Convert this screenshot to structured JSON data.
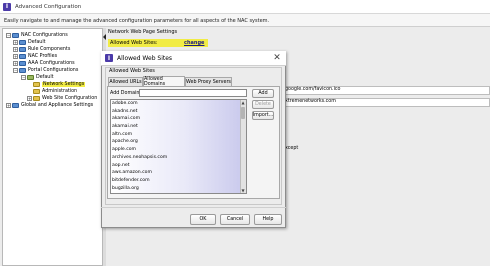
{
  "window": {
    "title": "Advanced Configuration"
  },
  "description": "Easily navigate to and manage the advanced configuration parameters for all aspects of the NAC system.",
  "tree": {
    "items": [
      {
        "label": "NAC Configurations",
        "toggle": "−"
      },
      {
        "label": "Default",
        "toggle": "+"
      },
      {
        "label": "Rule Components",
        "toggle": "+"
      },
      {
        "label": "NAC Profiles",
        "toggle": "+"
      },
      {
        "label": "AAA Configurations",
        "toggle": "+"
      },
      {
        "label": "Portal Configurations",
        "toggle": "−"
      },
      {
        "label": "Default",
        "toggle": "−"
      },
      {
        "label": "Network Settings",
        "toggle": ""
      },
      {
        "label": "Administration",
        "toggle": ""
      },
      {
        "label": "Web Site Configuration",
        "toggle": "+"
      },
      {
        "label": "Global and Appliance Settings",
        "toggle": "+"
      }
    ]
  },
  "right_panel": {
    "header": "Network Web Page Settings",
    "allowed_label": "Allowed Web Sites:",
    "change_link": "change",
    "field1": "google.com/favicon.ico",
    "field2": "xtremenetworks.com",
    "exception_text": "xcept"
  },
  "dialog": {
    "title": "Allowed Web Sites",
    "group_label": "Allowed Web Sites",
    "tabs": [
      "Allowed URLs",
      "Allowed Domains",
      "Web Proxy Servers"
    ],
    "active_tab": "Allowed Domains",
    "add_domain_label": "Add Domain:",
    "add_domain_value": "",
    "buttons": {
      "add": "Add",
      "delete": "Delete",
      "import": "Import..."
    },
    "domains": [
      "adobe.com",
      "akadns.net",
      "akamai.com",
      "akamai.net",
      "altn.com",
      "apache.org",
      "apple.com",
      "archives.neohapsis.com",
      "aop.net",
      "aws.amazon.com",
      "bitdefender.com",
      "bugzilla.org"
    ],
    "footer": {
      "ok": "OK",
      "cancel": "Cancel",
      "help": "Help"
    }
  },
  "colors": {
    "highlight": "#f1ec45",
    "app_icon": "#4b3aa8"
  }
}
